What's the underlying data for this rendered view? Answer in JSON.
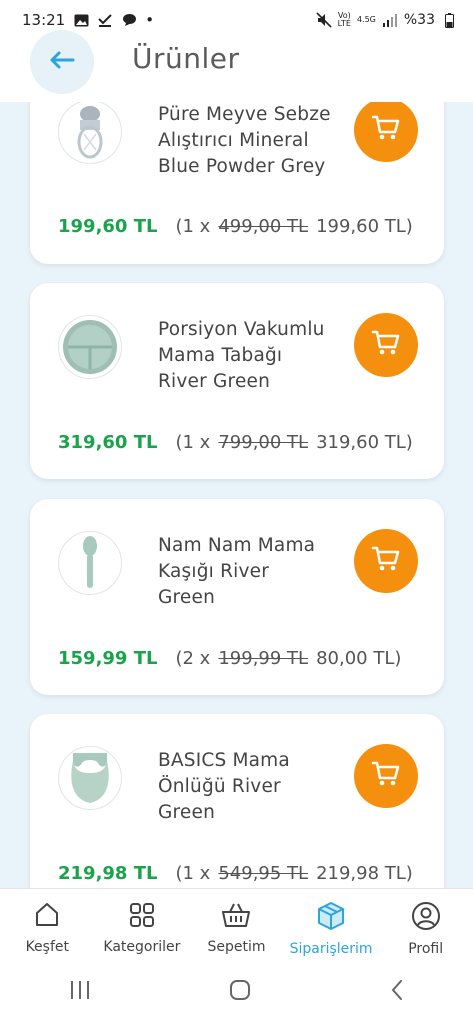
{
  "status_bar": {
    "time": "13:21",
    "dot": "•",
    "volte": "Vo)",
    "lte": "LTE",
    "net_type": "4.5G",
    "battery": "%33"
  },
  "header": {
    "title": "Ürünler",
    "back_icon": "arrow-left-icon"
  },
  "products": [
    {
      "name_lines": [
        "Püre Meyve Sebze",
        "Alıştırıcı Mineral",
        "Blue Powder Grey"
      ],
      "price": "199,60 TL",
      "open": "(1 x",
      "old_price": "499,00 TL",
      "unit_total": "199,60 TL)"
    },
    {
      "name_lines": [
        "Porsiyon Vakumlu",
        "Mama Tabağı",
        "River Green"
      ],
      "price": "319,60 TL",
      "open": "(1 x",
      "old_price": "799,00 TL",
      "unit_total": "319,60 TL)"
    },
    {
      "name_lines": [
        "Nam Nam Mama",
        "Kaşığı River",
        "Green"
      ],
      "price": "159,99 TL",
      "open": "(2 x",
      "old_price": "199,99 TL",
      "unit_total": "80,00 TL)"
    },
    {
      "name_lines": [
        "BASICS Mama",
        "Önlüğü River",
        "Green"
      ],
      "price": "219,98 TL",
      "open": "(1 x",
      "old_price": "549,95 TL",
      "unit_total": "219,98 TL)"
    }
  ],
  "bottom_nav": [
    {
      "label": "Keşfet",
      "icon": "home-icon",
      "active": false
    },
    {
      "label": "Kategoriler",
      "icon": "grid-icon",
      "active": false
    },
    {
      "label": "Sepetim",
      "icon": "basket-icon",
      "active": false
    },
    {
      "label": "Siparişlerim",
      "icon": "box-icon",
      "active": true
    },
    {
      "label": "Profil",
      "icon": "user-icon",
      "active": false
    }
  ],
  "colors": {
    "accent": "#2aa6dd",
    "cart_orange": "#f5900f",
    "price_green": "#1aa34a",
    "background": "#e9f3fa"
  }
}
